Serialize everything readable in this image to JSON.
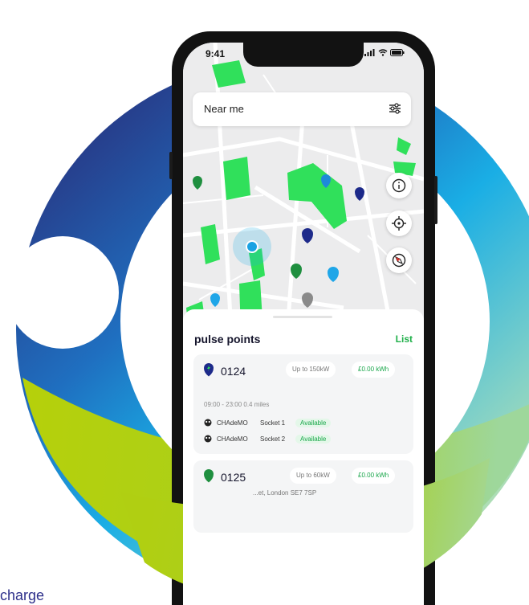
{
  "footer_text": "charge",
  "colors": {
    "ring_blue": "#1aaee5",
    "ring_navy": "#2b2f7e",
    "ring_green": "#b4d10a",
    "brand_green": "#20b04a",
    "park_green": "#2fe05a"
  },
  "phone": {
    "status_bar": {
      "time": "9:41",
      "icons": [
        "signal-icon",
        "wifi-icon",
        "battery-icon"
      ]
    },
    "search": {
      "placeholder": "Near me",
      "icon": "filter-icon"
    },
    "map_buttons": [
      "info-icon",
      "locate-icon",
      "compass-icon"
    ],
    "sheet": {
      "title": "pulse points",
      "list_link": "List",
      "cards": [
        {
          "id": "0124",
          "power": "Up to 150kW",
          "price": "£0.00 kWh",
          "hours_distance": "09:00 - 23:00   0.4 miles",
          "sockets": [
            {
              "type": "CHAdeMO",
              "name": "Socket 1",
              "status": "Available"
            },
            {
              "type": "CHAdeMO",
              "name": "Socket 2",
              "status": "Available"
            }
          ]
        },
        {
          "id": "0125",
          "power": "Up to 60kW",
          "price": "£0.00 kWh",
          "address": "...et, London SE7 7SP"
        }
      ]
    }
  }
}
